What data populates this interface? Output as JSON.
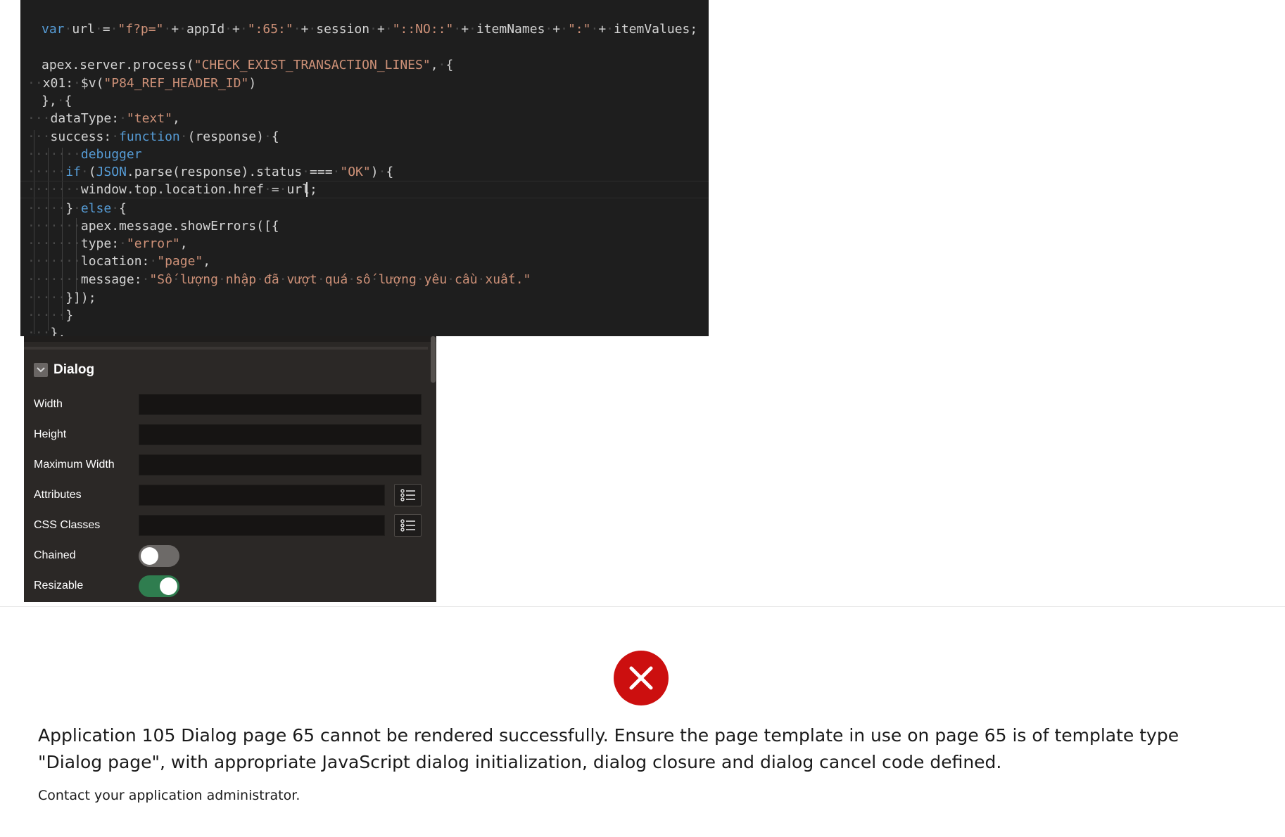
{
  "code": {
    "lines": [
      "var url = \"f?p=\" + appId + \":65:\" + session + \"::NO::\" + itemNames + \":\" + itemValues;",
      "apex.server.process(\"CHECK_EXIST_TRANSACTION_LINES\", {",
      "x01: $v(\"P84_REF_HEADER_ID\")",
      "}, {",
      "dataType: \"text\",",
      "success: function (response) {",
      "debugger",
      "if (JSON.parse(response).status === \"OK\") {",
      "window.top.location.href = url;",
      "} else {",
      "apex.message.showErrors([{",
      "type: \"error\",",
      "location: \"page\",",
      "message: \"Số lượng nhập đã vượt quá số lượng yêu cầu xuất.\"",
      "}]);",
      "}",
      "},"
    ]
  },
  "panel": {
    "section_title": "Dialog",
    "fields": {
      "width": "Width",
      "height": "Height",
      "max_width": "Maximum Width",
      "attributes": "Attributes",
      "css_classes": "CSS Classes",
      "chained": "Chained",
      "resizable": "Resizable"
    },
    "toggles": {
      "chained": false,
      "resizable": true
    }
  },
  "error": {
    "message": "Application 105 Dialog page 65 cannot be rendered successfully. Ensure the page template in use on page 65 is of template type \"Dialog page\", with appropriate JavaScript dialog initialization, dialog closure and dialog cancel code defined.",
    "hint": "Contact your application administrator.",
    "icon": "error-x-icon",
    "color": "#cc0f0f"
  }
}
